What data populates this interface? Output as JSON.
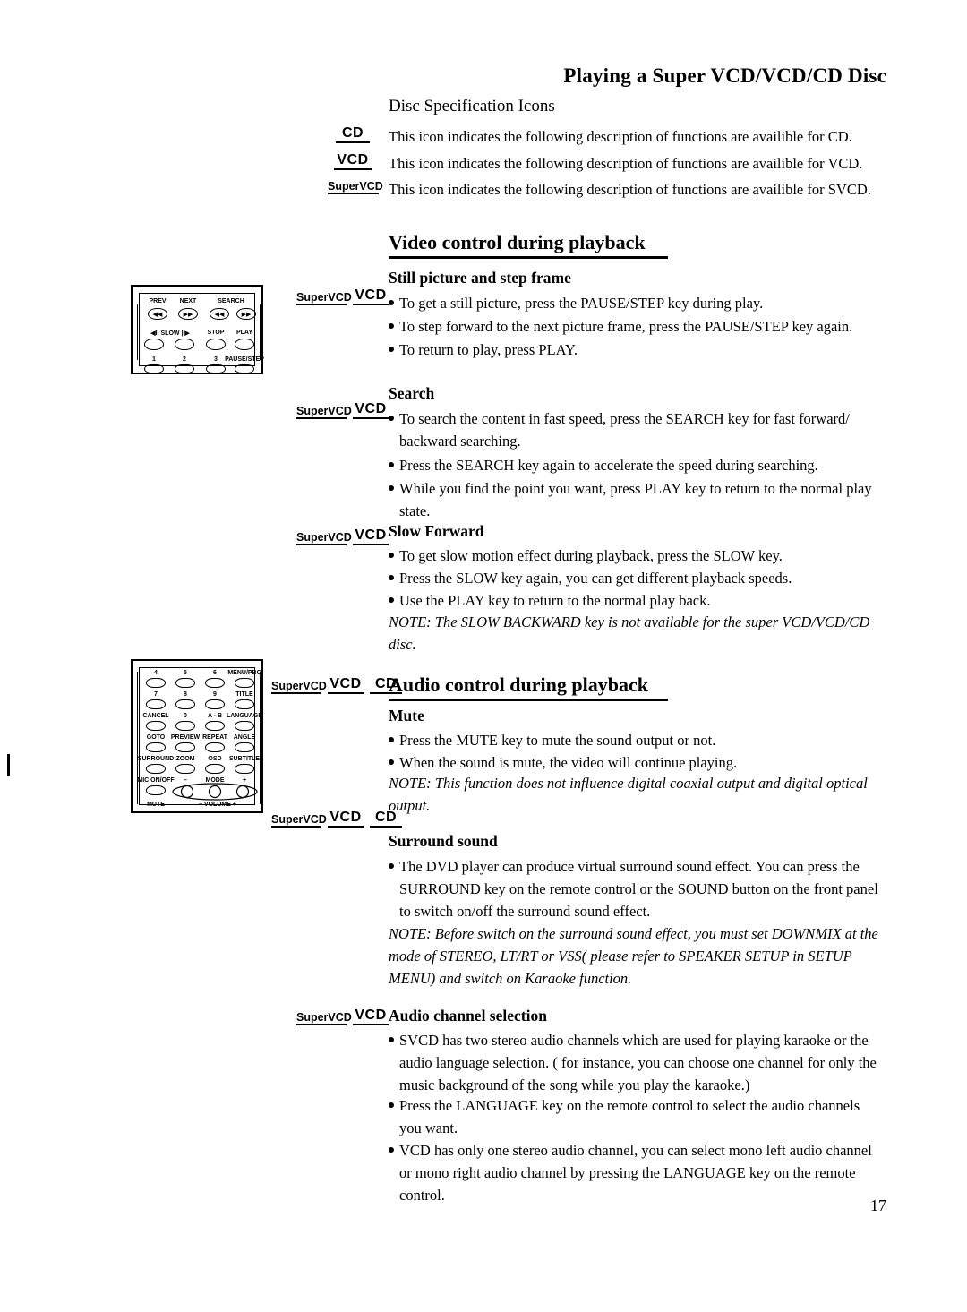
{
  "header": {
    "title": "Playing a Super VCD/VCD/CD Disc"
  },
  "disc_spec": {
    "heading": "Disc Specification Icons",
    "rows": [
      {
        "badge": "CD",
        "text": "This icon indicates the following description of functions  are availible for CD."
      },
      {
        "badge": "VCD",
        "text": "This icon indicates the following description of functions  are availible for VCD."
      },
      {
        "badge": "SuperVCD",
        "text": "This icon indicates the following description of functions  are availible for SVCD."
      }
    ]
  },
  "video_section": {
    "title": "Video control during playback",
    "subsections": [
      {
        "title": "Still picture and step frame",
        "badges": [
          "SuperVCD",
          "VCD"
        ],
        "bullets": [
          "To get a still picture, press the PAUSE/STEP key during play.",
          "To step forward to the next picture frame, press the PAUSE/STEP key again.",
          "To return to play, press PLAY."
        ]
      },
      {
        "title": "Search",
        "badges": [
          "SuperVCD",
          "VCD"
        ],
        "bullets": [
          "To search the content in fast speed, press the SEARCH key for fast forward/ backward searching.",
          "Press the SEARCH key again to accelerate the speed during searching.",
          "While you find the point you want, press PLAY key to return to the normal play state."
        ]
      },
      {
        "title": "Slow Forward",
        "badges": [
          "SuperVCD",
          "VCD"
        ],
        "bullets": [
          "To get slow motion effect during playback, press the SLOW key.",
          "Press the SLOW key again, you can get different playback speeds.",
          "Use the PLAY key to return to the normal play back."
        ],
        "note": "NOTE: The SLOW BACKWARD key is not available for the super VCD/VCD/CD disc."
      }
    ]
  },
  "audio_section": {
    "title": "Audio control during playback",
    "badges": [
      "SuperVCD",
      "VCD",
      "CD"
    ],
    "subsections": [
      {
        "title": "Mute",
        "bullets": [
          "Press the MUTE key to mute the sound output or not.",
          "When the sound is mute, the video will continue playing."
        ],
        "note": "NOTE: This function does not influence digital coaxial output and digital optical output."
      },
      {
        "title": "Surround sound",
        "badges": [
          "SuperVCD",
          "VCD",
          "CD"
        ],
        "bullets": [
          "The DVD player can produce virtual surround sound effect. You can press the SURROUND key on the remote control or the SOUND button on the front panel to switch on/off the surround sound effect."
        ],
        "note": "NOTE: Before switch on the surround sound effect, you must set DOWNMIX at the mode of STEREO, LT/RT or VSS( please refer to SPEAKER SETUP in SETUP MENU) and switch on Karaoke function."
      },
      {
        "title": "Audio channel selection",
        "badges": [
          "SuperVCD",
          "VCD"
        ],
        "bullets": [
          "SVCD has two stereo audio channels which are used for playing karaoke or the audio language selection. ( for instance, you can choose one channel for only the music background of the song while you play the karaoke.)",
          "Press the LANGUAGE key on the remote control to select the audio channels you want.",
          "VCD has only one stereo audio channel, you can select mono left audio channel or mono right audio channel by pressing the LANGUAGE key on the remote control."
        ]
      }
    ]
  },
  "remote_top": {
    "labels": [
      "PREV",
      "NEXT",
      "SEARCH"
    ],
    "glyphs_row1": [
      "◀◀",
      "▶▶",
      "◀◀",
      "▶▶"
    ],
    "row2_labels": [
      "◀I| SLOW |I▶",
      "STOP",
      "PLAY"
    ],
    "row3_labels": [
      "1",
      "2",
      "3",
      "PAUSE/STEP"
    ]
  },
  "remote_bottom": {
    "rows": [
      [
        "4",
        "5",
        "6",
        "MENU/PBC"
      ],
      [
        "7",
        "8",
        "9",
        "TITLE"
      ],
      [
        "CANCEL",
        "0",
        "A - B",
        "LANGUAGE"
      ],
      [
        "GOTO",
        "PREVIEW",
        "REPEAT",
        "ANGLE"
      ],
      [
        "SURROUND",
        "ZOOM",
        "OSD",
        "SUBTITLE"
      ],
      [
        "MIC ON/OFF",
        "–",
        "MODE",
        "+"
      ],
      [
        "MUTE",
        "–  VOLUME  +"
      ]
    ]
  },
  "page_number": "17"
}
